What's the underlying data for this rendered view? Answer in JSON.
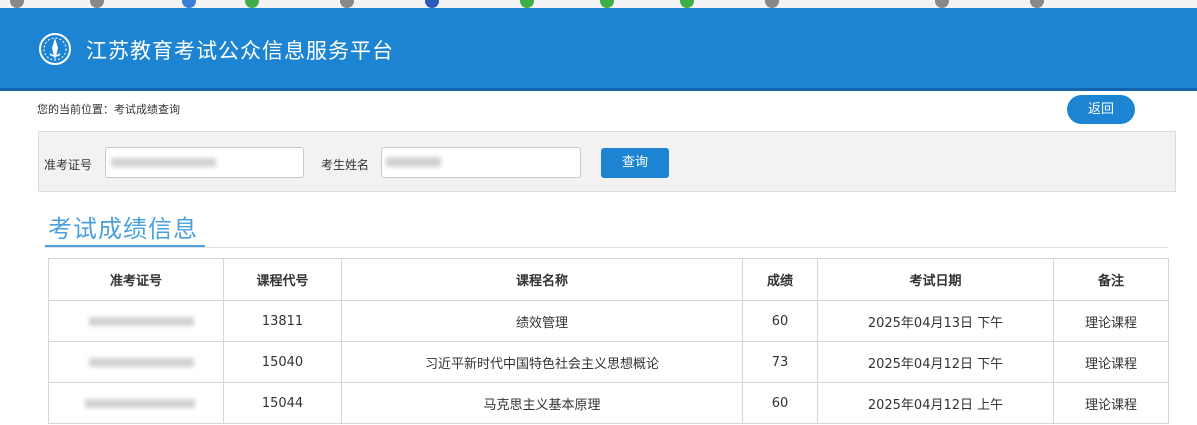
{
  "header": {
    "title": "江苏教育考试公众信息服务平台"
  },
  "breadcrumb": "您的当前位置：考试成绩查询",
  "back_button": "返回",
  "search": {
    "ticket_label": "准考证号",
    "name_label": "考生姓名",
    "query_button": "查询"
  },
  "section_title": "考试成绩信息",
  "table": {
    "columns": [
      "准考证号",
      "课程代号",
      "课程名称",
      "成绩",
      "考试日期",
      "备注"
    ],
    "rows": [
      {
        "code": "13811",
        "course": "绩效管理",
        "score": "60",
        "date": "2025年04月13日 下午",
        "note": "理论课程"
      },
      {
        "code": "15040",
        "course": "习近平新时代中国特色社会主义思想概论",
        "score": "73",
        "date": "2025年04月12日 下午",
        "note": "理论课程"
      },
      {
        "code": "15044",
        "course": "马克思主义基本原理",
        "score": "60",
        "date": "2025年04月12日 上午",
        "note": "理论课程"
      }
    ]
  },
  "colors": {
    "brand": "#1c84d3",
    "section": "#4aa0dd"
  }
}
